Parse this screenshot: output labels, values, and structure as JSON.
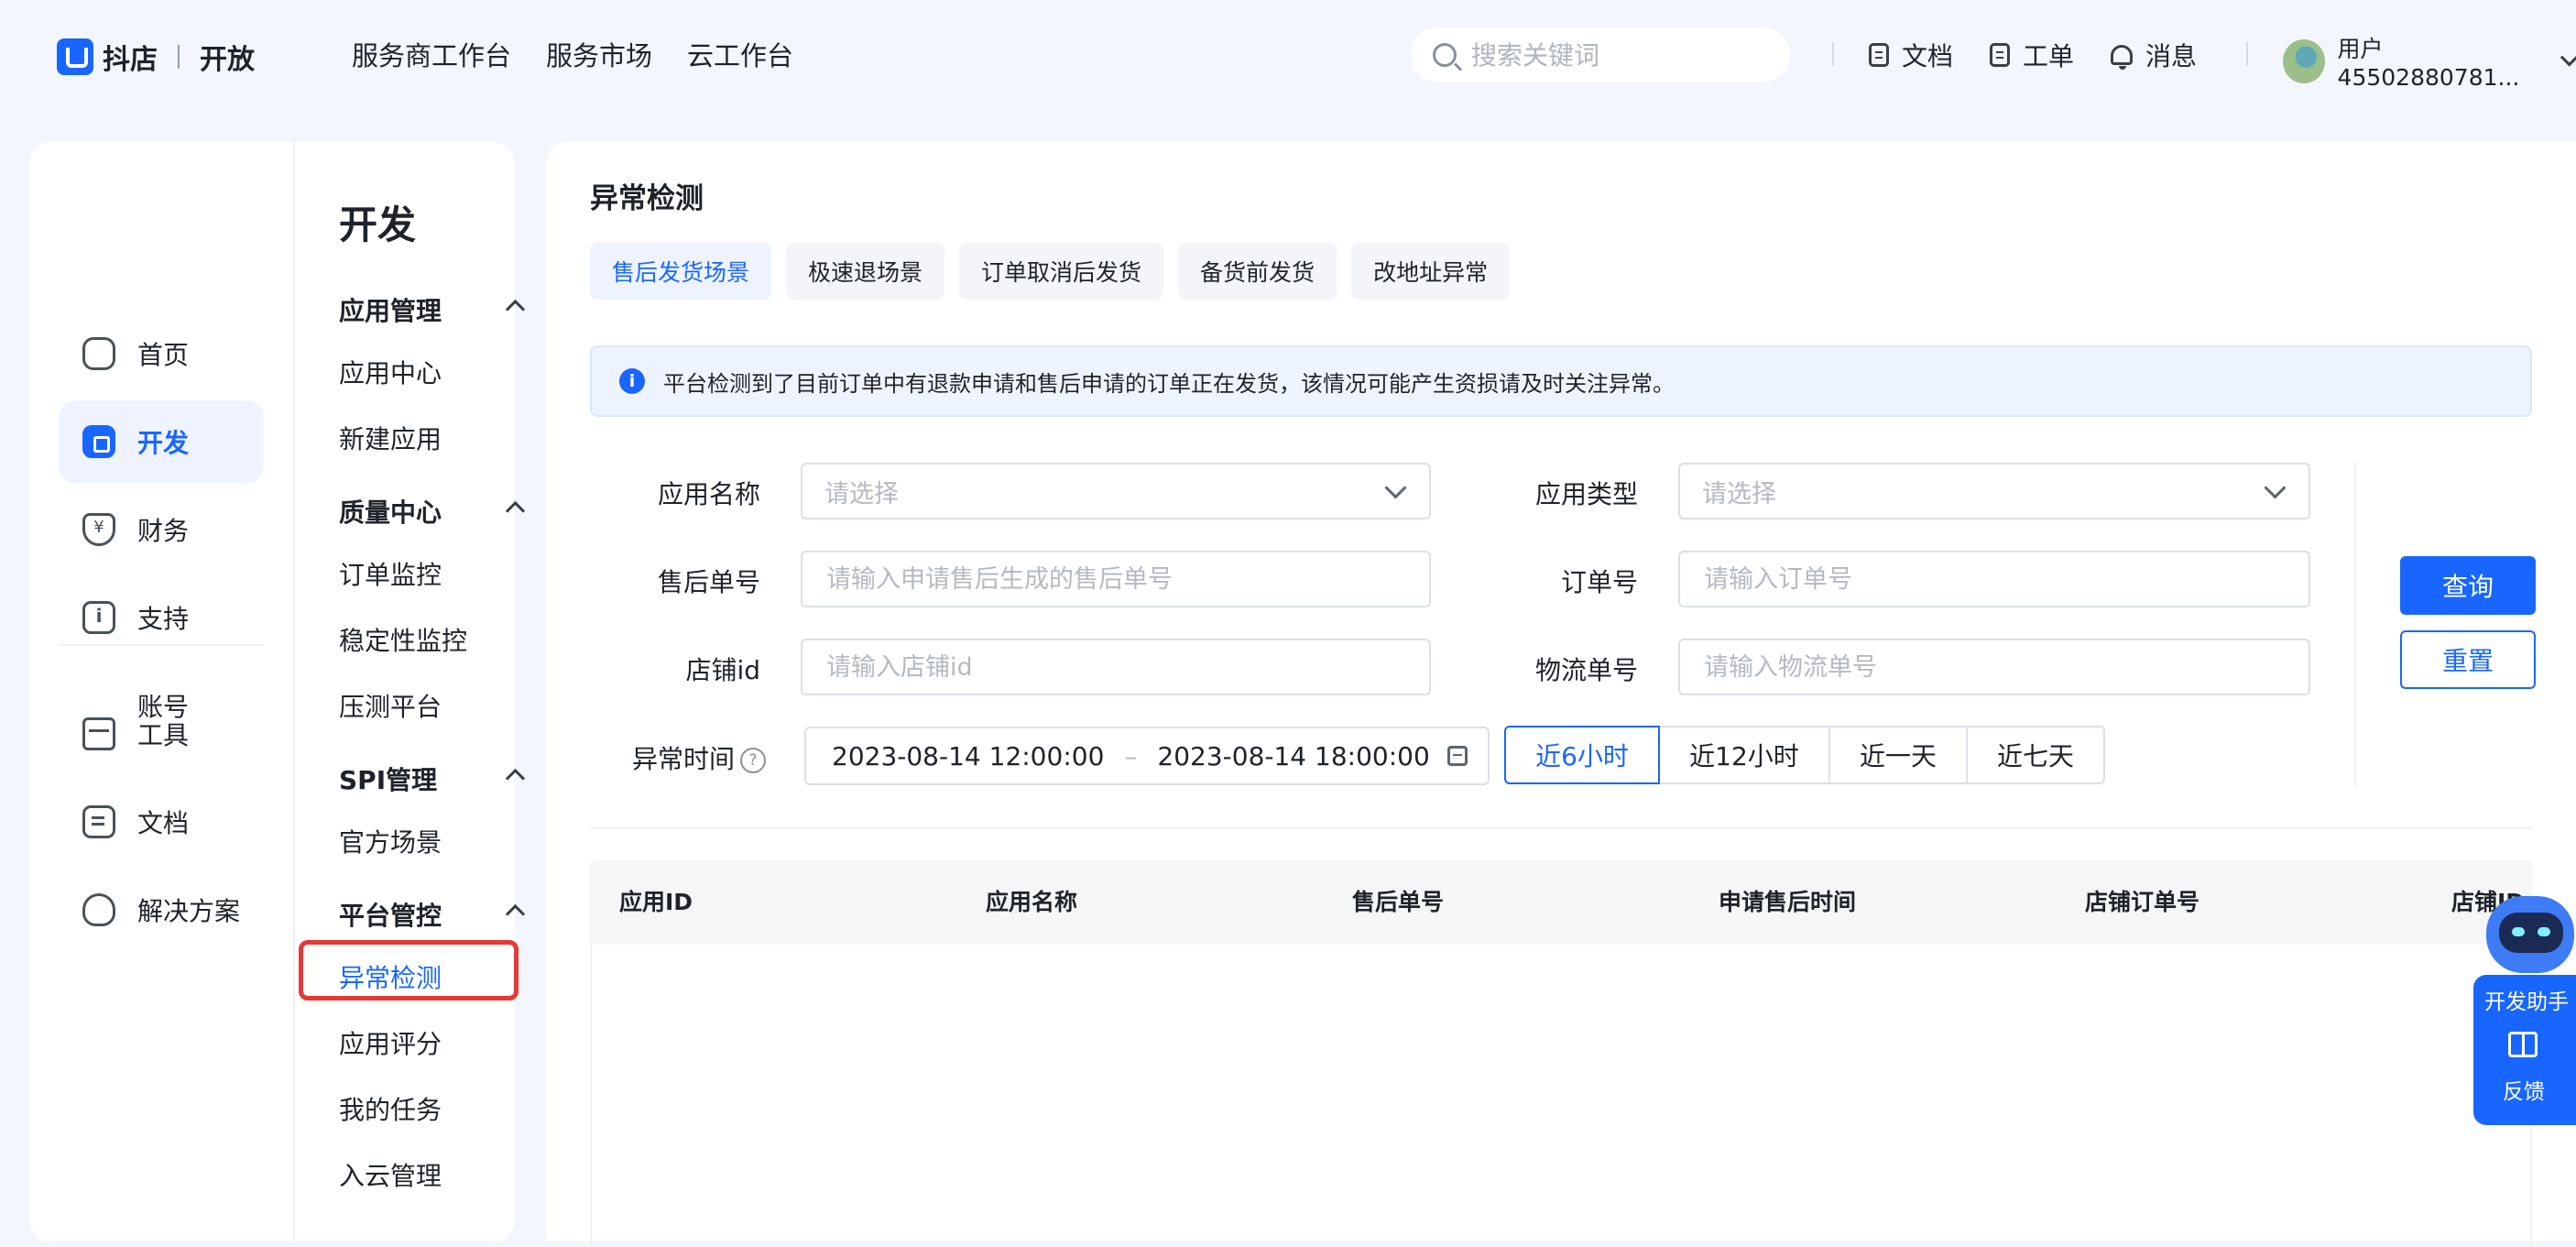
{
  "brand": {
    "name": "抖店",
    "product": "开放"
  },
  "topnav": [
    "服务商工作台",
    "服务市场",
    "云工作台"
  ],
  "search": {
    "placeholder": "搜索关键词"
  },
  "toplinks": {
    "docs": "文档",
    "ticket": "工单",
    "messages": "消息"
  },
  "user": {
    "name": "用户45502880781..."
  },
  "sidebar": {
    "items": [
      {
        "label": "首页",
        "icon": "home-icon"
      },
      {
        "label": "开发",
        "icon": "cube-icon",
        "active": true
      },
      {
        "label": "财务",
        "icon": "finance-icon"
      },
      {
        "label": "支持",
        "icon": "info-icon"
      },
      {
        "label": "账号",
        "icon": "account-icon"
      }
    ],
    "bottom": [
      {
        "label": "工具",
        "icon": "toolbox-icon"
      },
      {
        "label": "文档",
        "icon": "doc-icon"
      },
      {
        "label": "解决方案",
        "icon": "bulb-icon"
      }
    ]
  },
  "subnav": {
    "title": "开发",
    "groups": [
      {
        "label": "应用管理",
        "items": [
          "应用中心",
          "新建应用"
        ]
      },
      {
        "label": "质量中心",
        "items": [
          "订单监控",
          "稳定性监控",
          "压测平台"
        ]
      },
      {
        "label": "SPI管理",
        "items": [
          "官方场景"
        ]
      },
      {
        "label": "平台管控",
        "items": [
          "异常检测",
          "应用评分",
          "我的任务",
          "入云管理"
        ]
      }
    ],
    "active": "异常检测"
  },
  "page": {
    "title": "异常检测",
    "tabs": [
      "售后发货场景",
      "极速退场景",
      "订单取消后发货",
      "备货前发货",
      "改地址异常"
    ],
    "active_tab": "售后发货场景",
    "notice": "平台检测到了目前订单中有退款申请和售后申请的订单正在发货，该情况可能产生资损请及时关注异常。"
  },
  "form": {
    "app_name": {
      "label": "应用名称",
      "placeholder": "请选择"
    },
    "app_type": {
      "label": "应用类型",
      "placeholder": "请选择"
    },
    "aftersale_no": {
      "label": "售后单号",
      "placeholder": "请输入申请售后生成的售后单号"
    },
    "order_no": {
      "label": "订单号",
      "placeholder": "请输入订单号"
    },
    "shop_id": {
      "label": "店铺id",
      "placeholder": "请输入店铺id"
    },
    "logistics_no": {
      "label": "物流单号",
      "placeholder": "请输入物流单号"
    },
    "time": {
      "label": "异常时间",
      "start": "2023-08-14 12:00:00",
      "end": "2023-08-14 18:00:00",
      "separator": "–"
    },
    "quick_ranges": [
      "近6小时",
      "近12小时",
      "近一天",
      "近七天"
    ],
    "active_range": "近6小时",
    "query": "查询",
    "reset": "重置"
  },
  "table": {
    "columns": [
      "应用ID",
      "应用名称",
      "售后单号",
      "申请售后时间",
      "店铺订单号",
      "店铺ID"
    ]
  },
  "assistant": {
    "label": "开发助手",
    "feedback": "反馈"
  },
  "colors": {
    "primary": "#1966ff",
    "highlight": "#e53935",
    "background": "#f3f6fc"
  }
}
